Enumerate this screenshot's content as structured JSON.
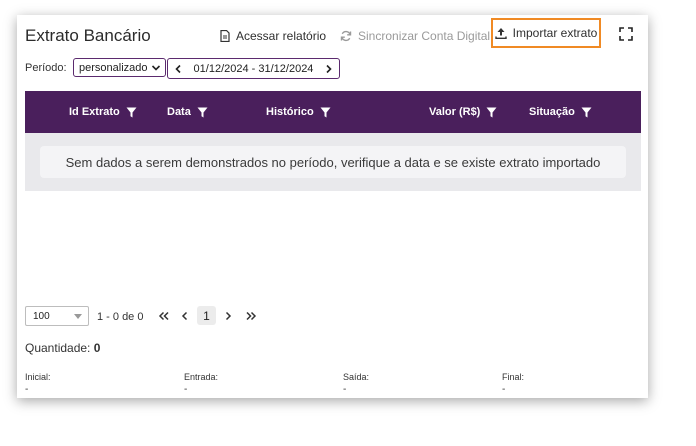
{
  "header": {
    "title": "Extrato Bancário",
    "actions": {
      "report": "Acessar relatório",
      "sync": "Sincronizar Conta Digital",
      "import": "Importar extrato"
    }
  },
  "filters": {
    "period_label": "Período:",
    "period_value": "personalizado",
    "date_range": "01/12/2024 - 31/12/2024"
  },
  "table": {
    "columns": [
      {
        "label": "Id Extrato"
      },
      {
        "label": "Data"
      },
      {
        "label": "Histórico"
      },
      {
        "label": "Valor (R$)"
      },
      {
        "label": "Situação"
      }
    ],
    "empty_message": "Sem dados a serem demonstrados no período, verifique a data e se existe extrato importado"
  },
  "pagination": {
    "page_size": "100",
    "range": "1 - 0 de 0",
    "current_page": "1"
  },
  "summary": {
    "quantity_label": "Quantidade:",
    "quantity_value": "0",
    "items": [
      {
        "label": "Inicial:",
        "value": "-"
      },
      {
        "label": "Entrada:",
        "value": "-"
      },
      {
        "label": "Saída:",
        "value": "-"
      },
      {
        "label": "Final:",
        "value": "-"
      }
    ]
  },
  "colors": {
    "header_bg": "#4a1f5c",
    "highlight": "#f08a24",
    "accent_border": "#5b2a6e"
  }
}
